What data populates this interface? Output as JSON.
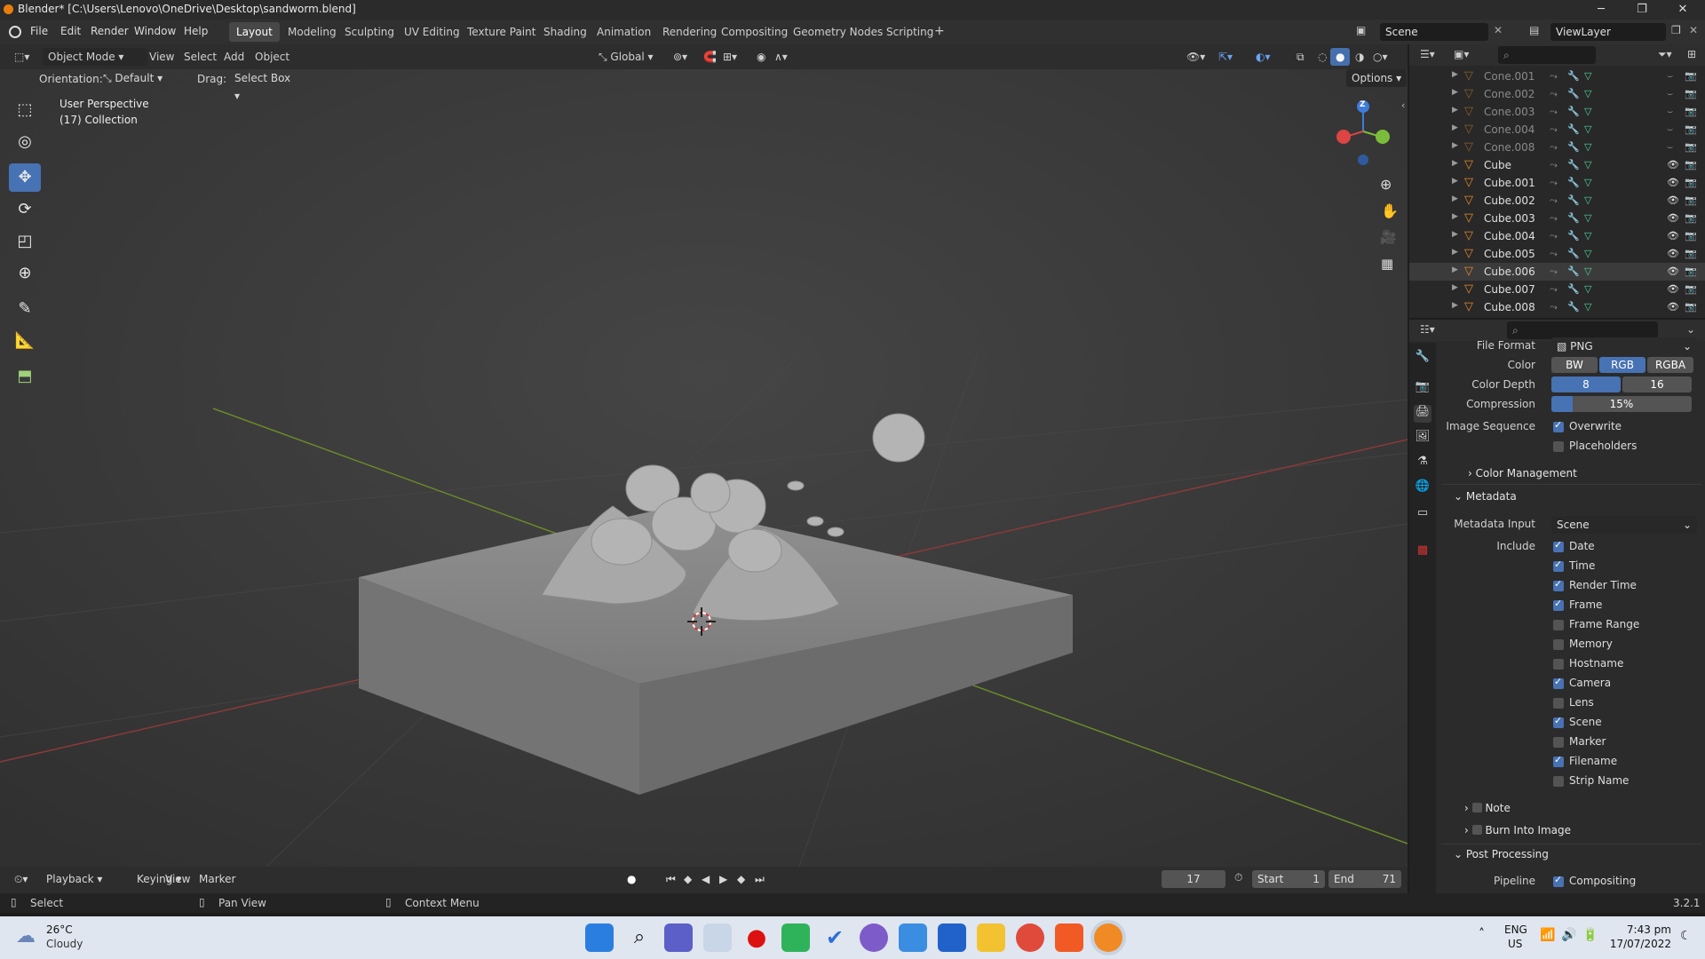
{
  "window": {
    "title": "Blender* [C:\\Users\\Lenovo\\OneDrive\\Desktop\\sandworm.blend]",
    "minimize": "─",
    "maximize": "❐",
    "close": "✕"
  },
  "menu": {
    "file": "File",
    "edit": "Edit",
    "render": "Render",
    "window": "Window",
    "help": "Help"
  },
  "workspaces": [
    "Layout",
    "Modeling",
    "Sculpting",
    "UV Editing",
    "Texture Paint",
    "Shading",
    "Animation",
    "Rendering",
    "Compositing",
    "Geometry Nodes",
    "Scripting"
  ],
  "workspace_add": "+",
  "scene": {
    "scene_label": "Scene",
    "viewlayer_label": "ViewLayer"
  },
  "viewport_header": {
    "mode": "Object Mode",
    "view": "View",
    "select": "Select",
    "add": "Add",
    "object": "Object",
    "transform_orientation": "Global",
    "orientation_label": "Orientation:",
    "orientation_value": "Default",
    "drag_label": "Drag:",
    "drag_value": "Select Box",
    "options": "Options"
  },
  "viewport_overlay": {
    "perspective": "User Perspective",
    "collection": "(17) Collection"
  },
  "gizmo": {
    "z": "Z"
  },
  "outliner": {
    "items": [
      {
        "name": "Cone.001",
        "dim": true
      },
      {
        "name": "Cone.002",
        "dim": true
      },
      {
        "name": "Cone.003",
        "dim": true
      },
      {
        "name": "Cone.004",
        "dim": true
      },
      {
        "name": "Cone.008",
        "dim": true
      },
      {
        "name": "Cube",
        "dim": false
      },
      {
        "name": "Cube.001",
        "dim": false
      },
      {
        "name": "Cube.002",
        "dim": false
      },
      {
        "name": "Cube.003",
        "dim": false
      },
      {
        "name": "Cube.004",
        "dim": false
      },
      {
        "name": "Cube.005",
        "dim": false
      },
      {
        "name": "Cube.006",
        "dim": false,
        "selected": true
      },
      {
        "name": "Cube.007",
        "dim": false
      },
      {
        "name": "Cube.008",
        "dim": false
      }
    ]
  },
  "properties": {
    "file_format_label": "File Format",
    "file_format_value": "PNG",
    "color_label": "Color",
    "color_options": [
      "BW",
      "RGB",
      "RGBA"
    ],
    "color_selected": "RGB",
    "depth_label": "Color Depth",
    "depth_options": [
      "8",
      "16"
    ],
    "depth_selected": "8",
    "compression_label": "Compression",
    "compression_value": "15%",
    "compression_fraction": 0.15,
    "image_sequence_label": "Image Sequence",
    "overwrite": {
      "label": "Overwrite",
      "checked": true
    },
    "placeholders": {
      "label": "Placeholders",
      "checked": false
    },
    "color_management": "Color Management",
    "metadata": "Metadata",
    "metadata_input_label": "Metadata Input",
    "metadata_input_value": "Scene",
    "include_label": "Include",
    "include": [
      {
        "label": "Date",
        "checked": true
      },
      {
        "label": "Time",
        "checked": true
      },
      {
        "label": "Render Time",
        "checked": true
      },
      {
        "label": "Frame",
        "checked": true
      },
      {
        "label": "Frame Range",
        "checked": false
      },
      {
        "label": "Memory",
        "checked": false
      },
      {
        "label": "Hostname",
        "checked": false
      },
      {
        "label": "Camera",
        "checked": true
      },
      {
        "label": "Lens",
        "checked": false
      },
      {
        "label": "Scene",
        "checked": true
      },
      {
        "label": "Marker",
        "checked": false
      },
      {
        "label": "Filename",
        "checked": true
      },
      {
        "label": "Strip Name",
        "checked": false
      }
    ],
    "note": "Note",
    "burn_into_image": "Burn Into Image",
    "post_processing": "Post Processing",
    "pipeline_label": "Pipeline",
    "compositing": {
      "label": "Compositing",
      "checked": true
    }
  },
  "timeline": {
    "playback": "Playback",
    "keying": "Keying",
    "view": "View",
    "marker": "Marker",
    "current_frame": "17",
    "start_label": "Start",
    "start_value": "1",
    "end_label": "End",
    "end_value": "71"
  },
  "statusbar": {
    "select": "Select",
    "pan_view": "Pan View",
    "context_menu": "Context Menu",
    "version": "3.2.1"
  },
  "taskbar": {
    "temperature": "26°C",
    "weather": "Cloudy",
    "lang": "ENG",
    "region": "US",
    "time": "7:43 pm",
    "date": "17/07/2022"
  }
}
